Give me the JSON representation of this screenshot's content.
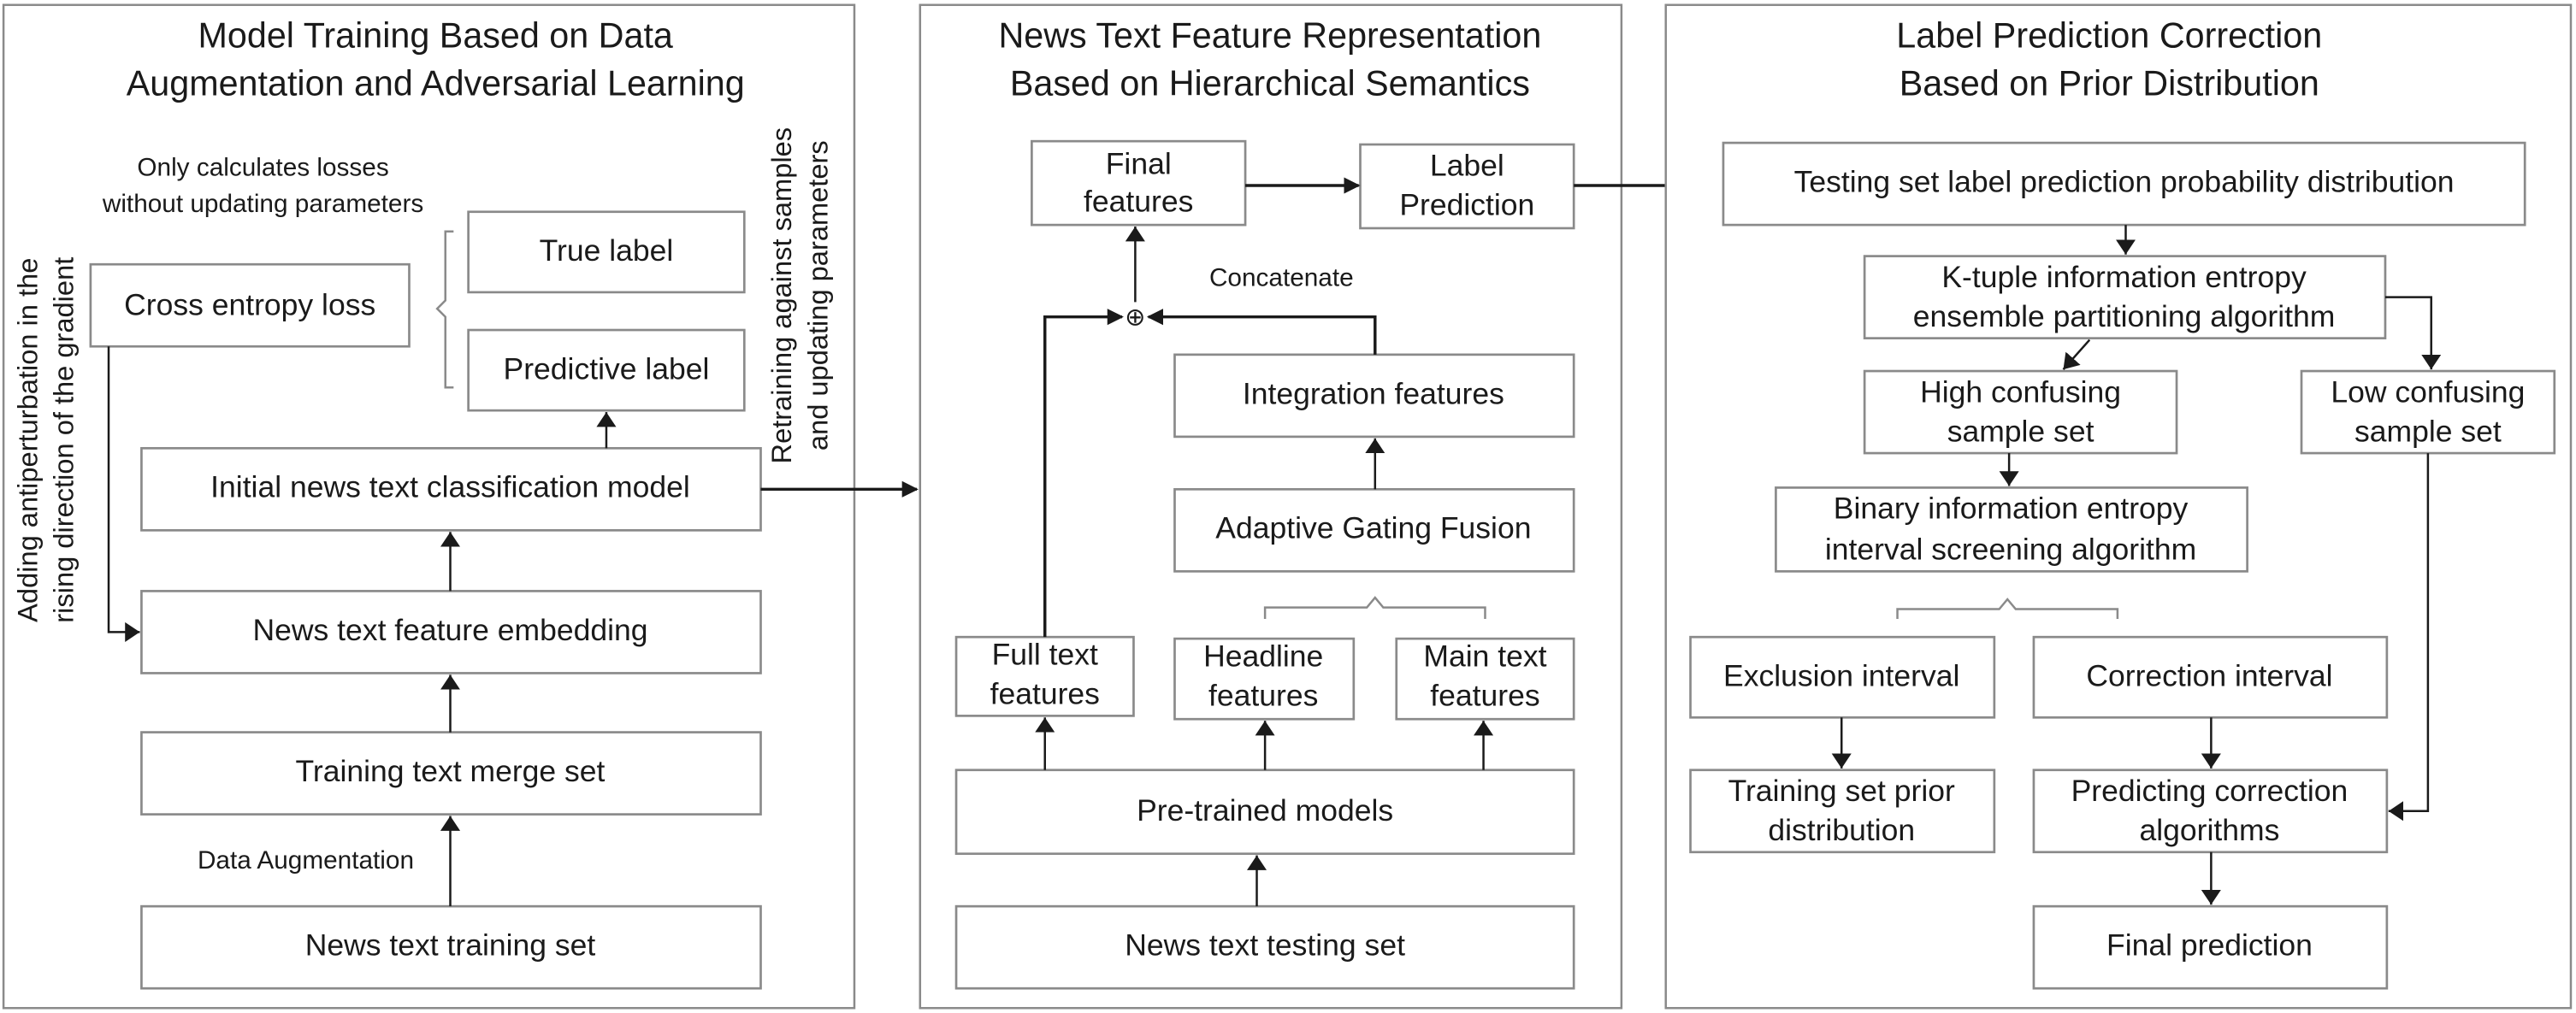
{
  "panels": {
    "training": {
      "title_line1": "Model Training Based on Data",
      "title_line2": "Augmentation and Adversarial Learning",
      "note_loss_line1": "Only calculates losses",
      "note_loss_line2": "without updating parameters",
      "vertical_note_line1": "Adding antiperturbation in the",
      "vertical_note_line2": "rising direction of the gradient",
      "retrain_note_line1": "Retraining against samples",
      "retrain_note_line2": "and updating parameters",
      "data_augmentation_label": "Data Augmentation",
      "boxes": {
        "true_label": "True label",
        "cross_entropy": "Cross entropy loss",
        "predictive_label": "Predictive label",
        "initial_model": "Initial news text classification model",
        "feature_embedding": "News text feature embedding",
        "merge_set": "Training text merge set",
        "training_set": "News text training set"
      }
    },
    "representation": {
      "title_line1": "News Text Feature Representation",
      "title_line2": "Based on Hierarchical Semantics",
      "concatenate_label": "Concatenate",
      "concat_symbol": "⊕",
      "boxes": {
        "final_features_line1": "Final",
        "final_features_line2": "features",
        "label_prediction_line1": "Label",
        "label_prediction_line2": "Prediction",
        "integration_features": "Integration features",
        "adaptive_gating": "Adaptive Gating Fusion",
        "full_text_line1": "Full text",
        "full_text_line2": "features",
        "headline_line1": "Headline",
        "headline_line2": "features",
        "main_text_line1": "Main text",
        "main_text_line2": "features",
        "pretrained": "Pre-trained models",
        "testing_set": "News text testing set"
      }
    },
    "correction": {
      "title_line1": "Label Prediction Correction",
      "title_line2": "Based on Prior Distribution",
      "boxes": {
        "prob_distribution": "Testing set label prediction probability distribution",
        "ktuple_line1": "K-tuple information entropy",
        "ktuple_line2": "ensemble partitioning algorithm",
        "high_confusing_line1": "High confusing",
        "high_confusing_line2": "sample set",
        "low_confusing_line1": "Low confusing",
        "low_confusing_line2": "sample set",
        "binary_line1": "Binary information entropy",
        "binary_line2": "interval screening algorithm",
        "exclusion_interval": "Exclusion interval",
        "correction_interval": "Correction interval",
        "prior_line1": "Training set prior",
        "prior_line2": "distribution",
        "predicting_line1": "Predicting correction",
        "predicting_line2": "algorithms",
        "final_prediction": "Final prediction"
      }
    }
  }
}
